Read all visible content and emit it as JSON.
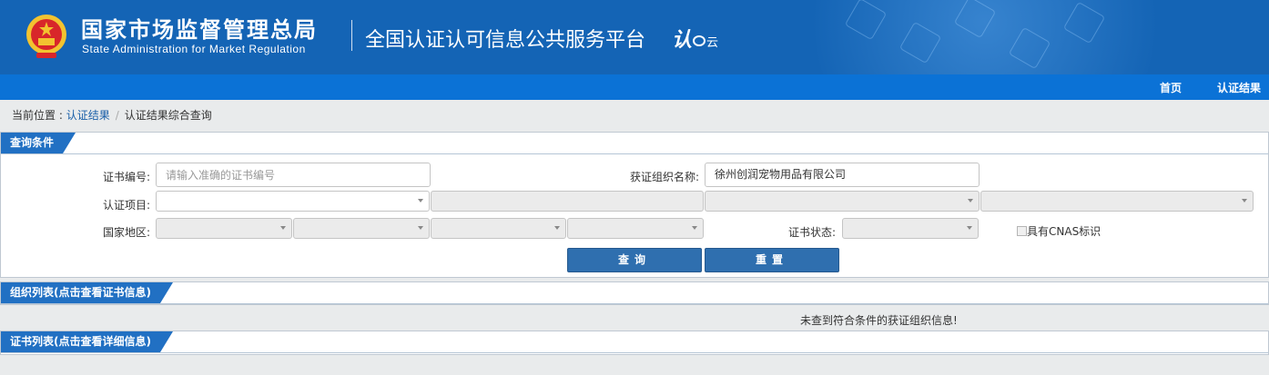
{
  "header": {
    "title_cn": "国家市场监督管理总局",
    "title_en": "State Administration  for  Market Regulation",
    "platform_name": "全国认证认可信息公共服务平台",
    "logo_text_main": "认",
    "logo_text_small": "云",
    "brand_color": "#1464b5"
  },
  "nav": {
    "home": "首页",
    "cert_results": "认证结果"
  },
  "breadcrumb": {
    "prefix": "当前位置 : ",
    "parent": "认证结果",
    "separator": "/",
    "current": "认证结果综合查询"
  },
  "query_panel": {
    "title": "查询条件",
    "cert_no_label": "证书编号:",
    "cert_no_placeholder": "请输入准确的证书编号",
    "org_name_label": "获证组织名称:",
    "org_name_value": "徐州创润宠物用品有限公司",
    "project_label": "认证项目:",
    "region_label": "国家地区:",
    "status_label": "证书状态:",
    "cnas_label": "具有CNAS标识",
    "query_button": "查询",
    "reset_button": "重置"
  },
  "org_panel": {
    "title": "组织列表(点击查看证书信息)",
    "empty_message": "未查到符合条件的获证组织信息!"
  },
  "cert_panel": {
    "title": "证书列表(点击查看详细信息)"
  },
  "icons": {
    "emblem": "national-emblem-icon",
    "dropdown": "chevron-down-icon"
  }
}
